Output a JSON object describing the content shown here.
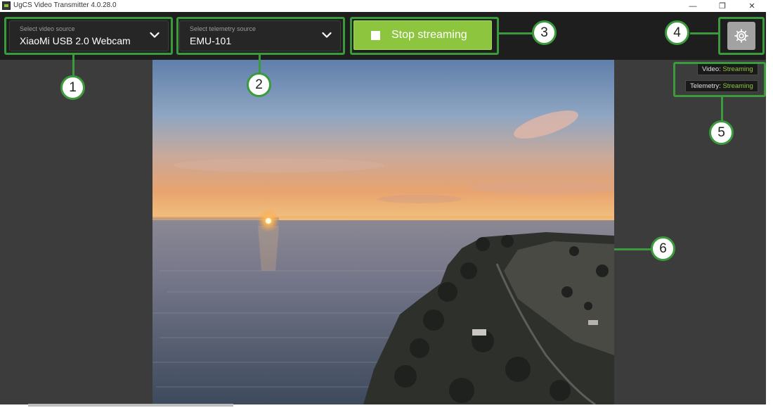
{
  "window": {
    "title": "UgCS Video Transmitter 4.0.28.0",
    "minimize": "—",
    "maximize": "❐",
    "close": "✕"
  },
  "toolbar": {
    "video_source": {
      "label": "Select video source",
      "value": "XiaoMi USB 2.0 Webcam"
    },
    "telemetry_source": {
      "label": "Select telemetry source",
      "value": "EMU-101"
    },
    "stream_button": {
      "label": "Stop streaming"
    },
    "settings_button": {
      "icon": "gear-icon"
    }
  },
  "status": {
    "video": {
      "label": "Video:",
      "value": "Streaming"
    },
    "telemetry": {
      "label": "Telemetry:",
      "value": "Streaming"
    }
  },
  "callouts": [
    "1",
    "2",
    "3",
    "4",
    "5",
    "6"
  ],
  "colors": {
    "accent_green": "#8dc53e",
    "callout_green": "#3b9a3b",
    "toolbar": "#1e1e1e",
    "background": "#3c3c3c"
  }
}
